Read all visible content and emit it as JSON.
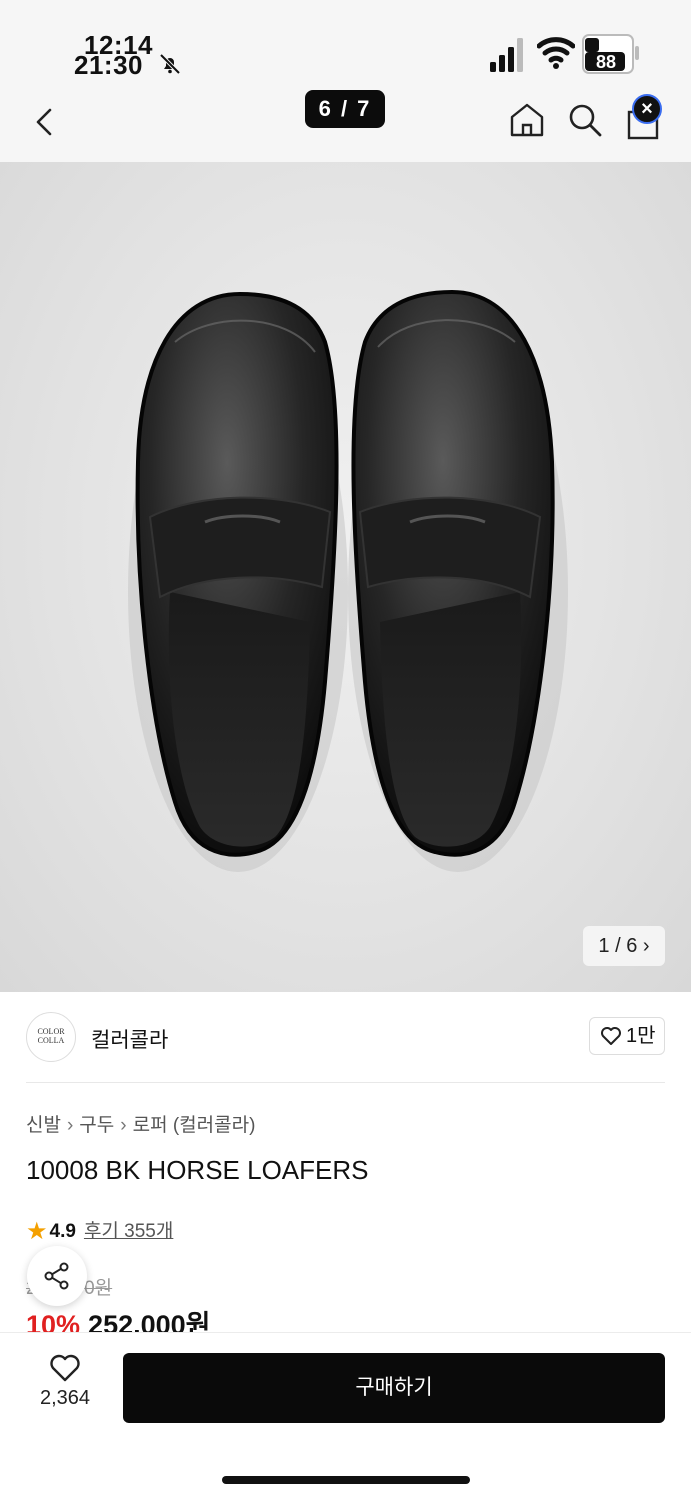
{
  "status_bar": {
    "time_primary": "12:14",
    "time_secondary": "21:30",
    "battery": "88",
    "icons": [
      "bell-slash-icon",
      "signal-icon",
      "wifi-icon",
      "battery-icon"
    ]
  },
  "nav": {
    "image_counter": "6 / 7",
    "icons": [
      "back-icon",
      "home-icon",
      "search-icon",
      "bag-icon"
    ],
    "close_badge": "×"
  },
  "gallery": {
    "pager": "1 / 6 ›",
    "image_alt": "black penny loafers top view",
    "background_color": "#e2e2e2"
  },
  "brand": {
    "logo_line1": "COLOR",
    "logo_line2": "COLLA",
    "name": "컬러콜라",
    "follow_count": "1만"
  },
  "breadcrumb": {
    "items": [
      "신발",
      "구두",
      "로퍼 (컬러콜라)"
    ],
    "separator": "›"
  },
  "product": {
    "title": "10008 BK HORSE LOAFERS",
    "rating": "4.9",
    "reviews": "후기 355개",
    "original_price": "280,000원",
    "discount": "10%",
    "price": "252,000원"
  },
  "bottom": {
    "like_count": "2,364",
    "buy_label": "구매하기"
  },
  "colors": {
    "accent_red": "#e02020",
    "star": "#f4a000",
    "button": "#0a0a0a"
  }
}
